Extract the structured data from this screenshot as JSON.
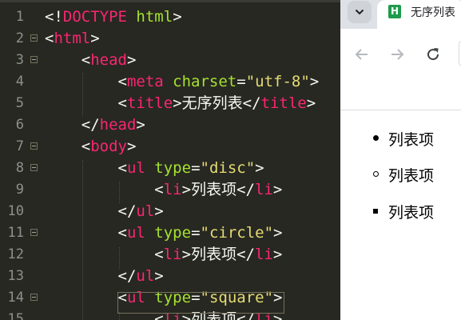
{
  "editor": {
    "lines": [
      {
        "num": "1",
        "fold": false,
        "tokens": [
          {
            "c": "t-punc",
            "t": "<!"
          },
          {
            "c": "t-tag",
            "t": "DOCTYPE"
          },
          {
            "c": "t-punc",
            "t": " "
          },
          {
            "c": "t-attr",
            "t": "html"
          },
          {
            "c": "t-punc",
            "t": ">"
          }
        ]
      },
      {
        "num": "2",
        "fold": true,
        "tokens": [
          {
            "c": "t-punc",
            "t": "<"
          },
          {
            "c": "t-tag",
            "t": "html"
          },
          {
            "c": "t-punc",
            "t": ">"
          }
        ]
      },
      {
        "num": "3",
        "fold": true,
        "tokens": [
          {
            "c": "t-punc",
            "t": "    <"
          },
          {
            "c": "t-tag",
            "t": "head"
          },
          {
            "c": "t-punc",
            "t": ">"
          }
        ]
      },
      {
        "num": "4",
        "fold": false,
        "tokens": [
          {
            "c": "t-punc",
            "t": "        <"
          },
          {
            "c": "t-tag",
            "t": "meta"
          },
          {
            "c": "t-punc",
            "t": " "
          },
          {
            "c": "t-attr",
            "t": "charset"
          },
          {
            "c": "t-punc",
            "t": "="
          },
          {
            "c": "t-str",
            "t": "\"utf-8\""
          },
          {
            "c": "t-punc",
            "t": ">"
          }
        ]
      },
      {
        "num": "5",
        "fold": false,
        "tokens": [
          {
            "c": "t-punc",
            "t": "        <"
          },
          {
            "c": "t-tag",
            "t": "title"
          },
          {
            "c": "t-punc",
            "t": ">"
          },
          {
            "c": "t-txt",
            "t": "无序列表"
          },
          {
            "c": "t-punc",
            "t": "</"
          },
          {
            "c": "t-tag",
            "t": "title"
          },
          {
            "c": "t-punc",
            "t": ">"
          }
        ]
      },
      {
        "num": "6",
        "fold": false,
        "tokens": [
          {
            "c": "t-punc",
            "t": "    </"
          },
          {
            "c": "t-tag",
            "t": "head"
          },
          {
            "c": "t-punc",
            "t": ">"
          }
        ]
      },
      {
        "num": "7",
        "fold": true,
        "tokens": [
          {
            "c": "t-punc",
            "t": "    <"
          },
          {
            "c": "t-tag",
            "t": "body"
          },
          {
            "c": "t-punc",
            "t": ">"
          }
        ]
      },
      {
        "num": "8",
        "fold": true,
        "tokens": [
          {
            "c": "t-punc",
            "t": "        <"
          },
          {
            "c": "t-tag",
            "t": "ul"
          },
          {
            "c": "t-punc",
            "t": " "
          },
          {
            "c": "t-attr",
            "t": "type"
          },
          {
            "c": "t-punc",
            "t": "="
          },
          {
            "c": "t-str",
            "t": "\"disc\""
          },
          {
            "c": "t-punc",
            "t": ">"
          }
        ]
      },
      {
        "num": "9",
        "fold": false,
        "tokens": [
          {
            "c": "t-punc",
            "t": "            <"
          },
          {
            "c": "t-tag",
            "t": "li"
          },
          {
            "c": "t-punc",
            "t": ">"
          },
          {
            "c": "t-txt",
            "t": "列表项"
          },
          {
            "c": "t-punc",
            "t": "</"
          },
          {
            "c": "t-tag",
            "t": "li"
          },
          {
            "c": "t-punc",
            "t": ">"
          }
        ]
      },
      {
        "num": "10",
        "fold": false,
        "tokens": [
          {
            "c": "t-punc",
            "t": "        </"
          },
          {
            "c": "t-tag",
            "t": "ul"
          },
          {
            "c": "t-punc",
            "t": ">"
          }
        ]
      },
      {
        "num": "11",
        "fold": true,
        "tokens": [
          {
            "c": "t-punc",
            "t": "        <"
          },
          {
            "c": "t-tag",
            "t": "ul"
          },
          {
            "c": "t-punc",
            "t": " "
          },
          {
            "c": "t-attr",
            "t": "type"
          },
          {
            "c": "t-punc",
            "t": "="
          },
          {
            "c": "t-str",
            "t": "\"circle\""
          },
          {
            "c": "t-punc",
            "t": ">"
          }
        ]
      },
      {
        "num": "12",
        "fold": false,
        "tokens": [
          {
            "c": "t-punc",
            "t": "            <"
          },
          {
            "c": "t-tag",
            "t": "li"
          },
          {
            "c": "t-punc",
            "t": ">"
          },
          {
            "c": "t-txt",
            "t": "列表项"
          },
          {
            "c": "t-punc",
            "t": "</"
          },
          {
            "c": "t-tag",
            "t": "li"
          },
          {
            "c": "t-punc",
            "t": ">"
          }
        ]
      },
      {
        "num": "13",
        "fold": false,
        "tokens": [
          {
            "c": "t-punc",
            "t": "        </"
          },
          {
            "c": "t-tag",
            "t": "ul"
          },
          {
            "c": "t-punc",
            "t": ">"
          }
        ]
      },
      {
        "num": "14",
        "fold": true,
        "tokens": [
          {
            "c": "t-punc",
            "t": "        <"
          },
          {
            "c": "t-tag",
            "t": "ul"
          },
          {
            "c": "t-punc",
            "t": " "
          },
          {
            "c": "t-attr",
            "t": "type"
          },
          {
            "c": "t-punc",
            "t": "="
          },
          {
            "c": "t-str",
            "t": "\"square\""
          },
          {
            "c": "t-punc",
            "t": ">"
          }
        ]
      },
      {
        "num": "15",
        "fold": false,
        "tokens": [
          {
            "c": "t-punc",
            "t": "            <"
          },
          {
            "c": "t-tag",
            "t": "li"
          },
          {
            "c": "t-punc",
            "t": ">"
          },
          {
            "c": "t-txt",
            "t": "列表项"
          },
          {
            "c": "t-punc",
            "t": "</"
          },
          {
            "c": "t-tag",
            "t": "li"
          },
          {
            "c": "t-punc",
            "t": ">"
          }
        ]
      }
    ]
  },
  "browser": {
    "tab_title": "无序列表",
    "favicon_letter": "H",
    "icons": [
      "chevron-down-icon",
      "back-arrow-icon",
      "forward-arrow-icon",
      "reload-icon"
    ],
    "list_items": [
      {
        "marker": "disc",
        "text": "列表项"
      },
      {
        "marker": "circle",
        "text": "列表项"
      },
      {
        "marker": "square",
        "text": "列表项"
      }
    ]
  },
  "colors": {
    "editor_bg": "#272822",
    "tag": "#f92672",
    "attr": "#a6e22e",
    "string": "#e6db74",
    "text": "#f8f8f2",
    "line_number": "#8f908a",
    "favicon": "#1e9b4c"
  }
}
